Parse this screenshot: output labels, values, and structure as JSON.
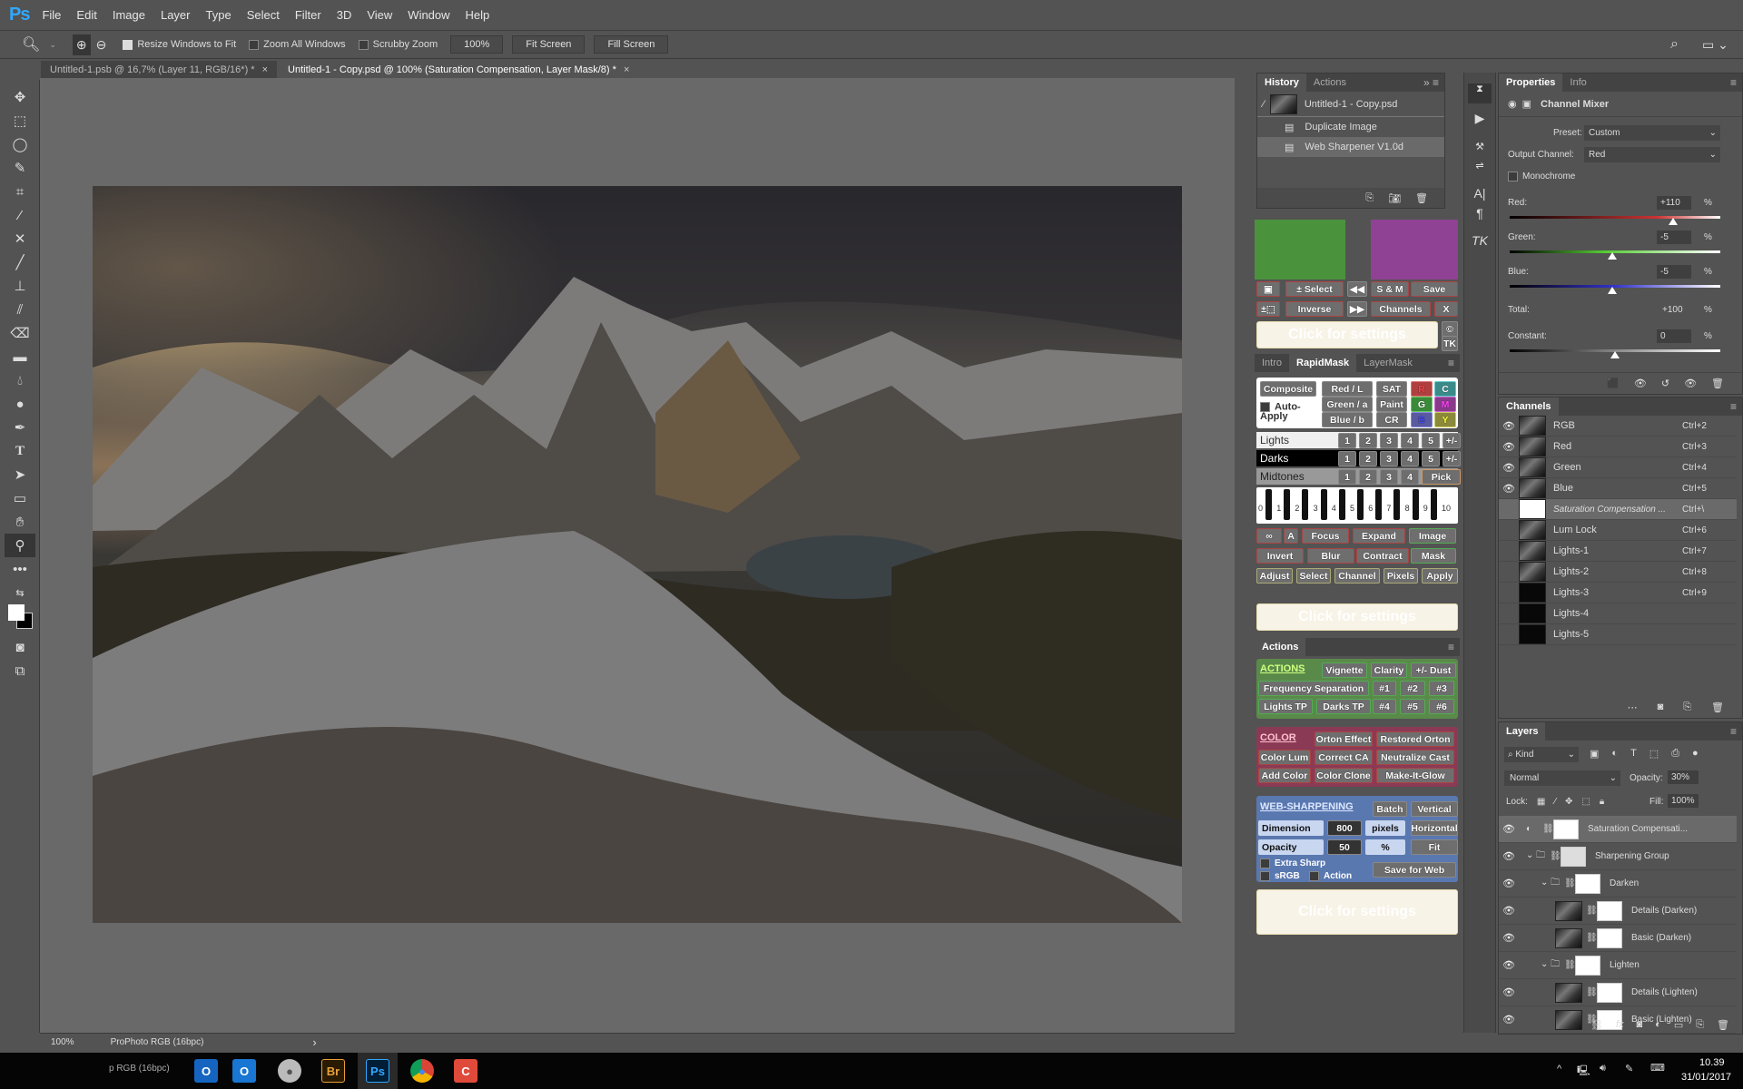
{
  "app": {
    "logo": "Ps"
  },
  "menu": [
    "File",
    "Edit",
    "Image",
    "Layer",
    "Type",
    "Select",
    "Filter",
    "3D",
    "View",
    "Window",
    "Help"
  ],
  "options": {
    "resize_windows": "Resize Windows to Fit",
    "zoom_all": "Zoom All Windows",
    "scrubby": "Scrubby Zoom",
    "zoom_value": "100%",
    "fit_screen": "Fit Screen",
    "fill_screen": "Fill Screen"
  },
  "tabs": [
    {
      "label": "Untitled-1.psb @ 16,7% (Layer 11, RGB/16*) *",
      "close": "×"
    },
    {
      "label": "Untitled-1 - Copy.psd @ 100% (Saturation Compensation, Layer Mask/8) *",
      "close": "×"
    }
  ],
  "status": {
    "zoom": "100%",
    "profile": "ProPhoto RGB (16bpc)",
    "arrow": "›"
  },
  "history": {
    "tabs": [
      "History",
      "Actions"
    ],
    "snapshot": "Untitled-1 - Copy.psd",
    "items": [
      "Duplicate Image",
      "Web Sharpener V1.0d"
    ]
  },
  "properties": {
    "tabs": [
      "Properties",
      "Info"
    ],
    "title": "Channel Mixer",
    "preset_label": "Preset:",
    "preset": "Custom",
    "output_label": "Output Channel:",
    "output": "Red",
    "monochrome": "Monochrome",
    "red_label": "Red:",
    "red": "+110",
    "green_label": "Green:",
    "green": "-5",
    "blue_label": "Blue:",
    "blue": "-5",
    "total_label": "Total:",
    "total": "+100",
    "constant_label": "Constant:",
    "constant": "0",
    "pct": "%",
    "red_value": 110,
    "green_value": -5,
    "blue_value": -5,
    "constant_value": 0
  },
  "channels": {
    "title": "Channels",
    "rows": [
      {
        "name": "RGB",
        "key": "Ctrl+2",
        "visible": true
      },
      {
        "name": "Red",
        "key": "Ctrl+3",
        "visible": true
      },
      {
        "name": "Green",
        "key": "Ctrl+4",
        "visible": true
      },
      {
        "name": "Blue",
        "key": "Ctrl+5",
        "visible": true
      },
      {
        "name": "Saturation Compensation ...",
        "key": "Ctrl+\\",
        "visible": false
      },
      {
        "name": "Lum Lock",
        "key": "Ctrl+6",
        "visible": false
      },
      {
        "name": "Lights-1",
        "key": "Ctrl+7",
        "visible": false
      },
      {
        "name": "Lights-2",
        "key": "Ctrl+8",
        "visible": false
      },
      {
        "name": "Lights-3",
        "key": "Ctrl+9",
        "visible": false
      },
      {
        "name": "Lights-4",
        "key": "",
        "visible": false
      },
      {
        "name": "Lights-5",
        "key": "",
        "visible": false
      }
    ]
  },
  "layers": {
    "title": "Layers",
    "kind": "Kind",
    "blend": "Normal",
    "opacity_label": "Opacity:",
    "opacity": "30%",
    "lock_label": "Lock:",
    "fill_label": "Fill:",
    "fill": "100%",
    "rows": [
      {
        "name": "Saturation Compensati...",
        "indent": 0
      },
      {
        "name": "Sharpening Group",
        "indent": 0
      },
      {
        "name": "Darken",
        "indent": 1
      },
      {
        "name": "Details (Darken)",
        "indent": 2
      },
      {
        "name": "Basic (Darken)",
        "indent": 2
      },
      {
        "name": "Lighten",
        "indent": 1
      },
      {
        "name": "Details (Lighten)",
        "indent": 2
      },
      {
        "name": "Basic (Lighten)",
        "indent": 2
      }
    ]
  },
  "tk": {
    "row1": [
      "± Select",
      "S & M",
      "Save"
    ],
    "row2": [
      "Inverse",
      "Channels",
      "X"
    ],
    "settings": "Click for settings",
    "rm_tabs": [
      "Intro",
      "RapidMask",
      "LayerMask"
    ],
    "composite": "Composite",
    "auto_apply": "Auto-Apply",
    "rgb": [
      "Red / L",
      "Green / a",
      "Blue / b"
    ],
    "sat": [
      "SAT",
      "Paint",
      "CR"
    ],
    "colors": [
      "R",
      "C",
      "G",
      "M",
      "B",
      "Y"
    ],
    "lights": "Lights",
    "darks": "Darks",
    "midtones": "Midtones",
    "pick": "Pick",
    "plusminus": "+/-",
    "zone_labels": [
      "0",
      "1",
      "2",
      "3",
      "4",
      "5",
      "6",
      "7",
      "8",
      "9",
      "10"
    ],
    "mask_row1": [
      "∞",
      "A",
      "Focus",
      "Expand",
      "Image"
    ],
    "mask_row2": [
      "Invert",
      "Blur",
      "Contract",
      "Mask"
    ],
    "mask_row3": [
      "Adjust",
      "Select",
      "Channel",
      "Pixels",
      "Apply"
    ],
    "actions_title": "Actions",
    "actions_head": "ACTIONS",
    "actions_r1": [
      "Vignette",
      "Clarity",
      "+/- Dust"
    ],
    "actions_r2": [
      "Frequency Separation",
      "#1",
      "#2",
      "#3"
    ],
    "actions_r3": [
      "Lights TP",
      "Darks TP",
      "#4",
      "#5",
      "#6"
    ],
    "color_head": "COLOR",
    "color_r1": [
      "Orton Effect",
      "Restored Orton"
    ],
    "color_r2": [
      "Color Lum",
      "Correct CA",
      "Neutralize Cast"
    ],
    "color_r3": [
      "Add Color",
      "Color Clone",
      "Make-It-Glow"
    ],
    "web_head": "WEB-SHARPENING",
    "batch": "Batch",
    "vertical": "Vertical",
    "dimension": "Dimension",
    "dim_val": "800",
    "pixels": "pixels",
    "horizontal": "Horizontal",
    "opacity": "Opacity",
    "op_val": "50",
    "pct": "%",
    "fit": "Fit",
    "extra": "Extra Sharp",
    "srgb": "sRGB",
    "action": "Action",
    "save_web": "Save for Web"
  },
  "taskbar": {
    "ghost": "p RGB (16bpc)",
    "time": "10.39",
    "date": "31/01/2017"
  }
}
